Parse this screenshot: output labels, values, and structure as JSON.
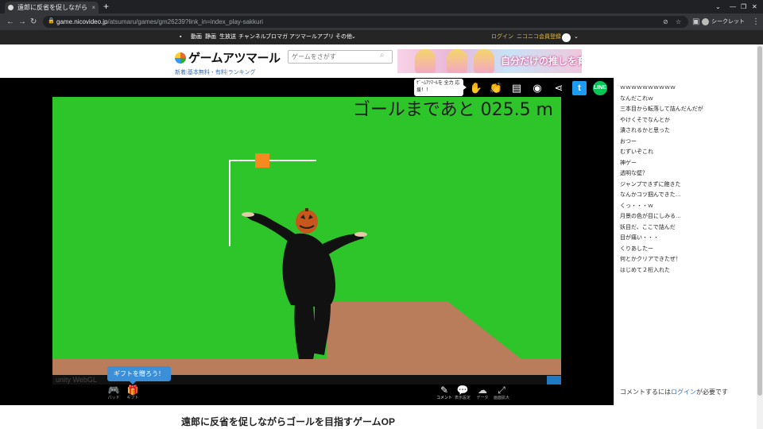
{
  "browser": {
    "tab_title": "遠郎に反省を促しながら",
    "tab_close": "×",
    "new_tab": "+",
    "url_domain": "game.nicovideo.jp",
    "url_path": "/atsumaru/games/gm26239?link_in=index_play-sakkuri",
    "incognito_label": "シークレット",
    "window_controls": [
      "⌄",
      "—",
      "❐",
      "✕"
    ]
  },
  "site_nav": {
    "items": [
      "動画",
      "静画",
      "生放送",
      "チャンネル",
      "ブロマガ",
      "アツマール",
      "アプリ",
      "その他"
    ],
    "login": "ログイン",
    "register": "ニコニコ会員登録"
  },
  "header": {
    "logo_text": "ゲームアツマール",
    "search_placeholder": "ゲームをさがす",
    "banner_text": "自分だけの推しを育成しよう！",
    "subnav": [
      "新着",
      "基本無料・有料",
      "ランキング"
    ]
  },
  "player_top": {
    "bubble_text": "ｹﾞｰﾑｱﾂﾏｰﾙを 全力 応援！！",
    "twitter_label": "t",
    "line_label": "LINE"
  },
  "game": {
    "distance_text": "ゴールまであと 025.5 m",
    "unity_text": "unity WebGL",
    "colors": {
      "sky": "#2ec52a",
      "ground": "#b97d5b",
      "block": "#f68a1e"
    }
  },
  "controls": {
    "gift_popup": "ギフトを贈ろう！",
    "left": [
      {
        "icon": "gamepad-icon",
        "label": "パッド"
      },
      {
        "icon": "gift-icon",
        "label": "ギフト"
      }
    ],
    "right": [
      {
        "icon": "comment-icon",
        "label": "コメント"
      },
      {
        "icon": "comment-settings-icon",
        "label": "表示設定"
      },
      {
        "icon": "cloud-icon",
        "label": "データ"
      },
      {
        "icon": "fullscreen-icon",
        "label": "画面拡大"
      }
    ]
  },
  "comments": {
    "items": [
      "ｗｗｗｗｗｗｗｗｗｗ",
      "なんだこれｗ",
      "三本目から転落して詰んだんだが",
      "やけくそでなんとか",
      "潰されるかと思った",
      "おつー",
      "むずいぞこれ",
      "神ゲー",
      "透明な壁？",
      "ジャンプできずに飽きた",
      "なんかコツ掴んできた…",
      "くっ・・・ｗ",
      "月景の色が目にしみる…",
      "妖目だ、ここで詰んだ",
      "目が痛い・・・",
      "くりあしたー",
      "何とかクリアできたぜ！",
      "はじめて２桁入れた"
    ],
    "footer_prefix": "コメントするには",
    "footer_link": "ログイン",
    "footer_suffix": "が必要です"
  },
  "page": {
    "game_title": "遠郎に反省を促しながらゴールを目指すゲームOP"
  }
}
